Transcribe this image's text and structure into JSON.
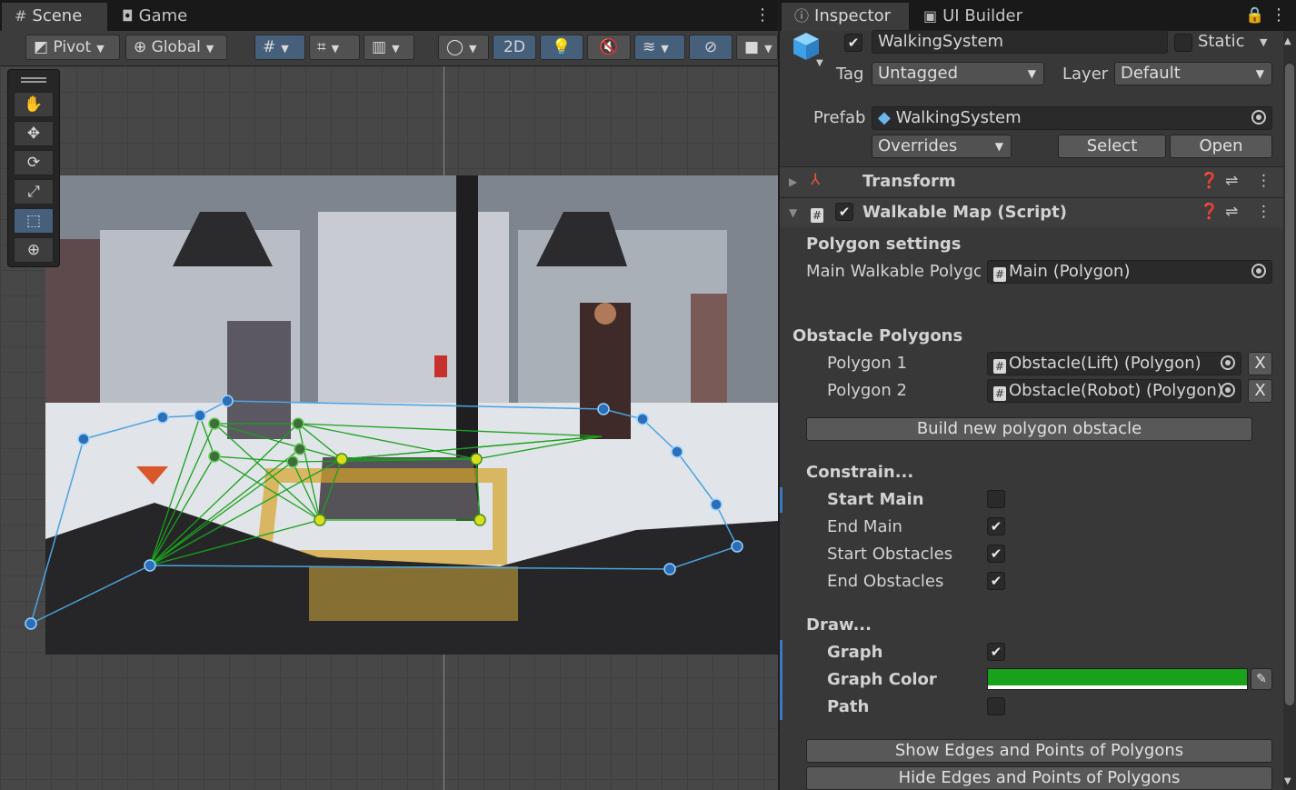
{
  "scene_window": {
    "tabs": [
      {
        "label": "Scene",
        "icon": "grid-icon"
      },
      {
        "label": "Game",
        "icon": "gamepad-icon"
      }
    ],
    "toolbar": {
      "pivot_label": "Pivot",
      "global_label": "Global",
      "mode_2d_label": "2D"
    },
    "tools": [
      "hand-tool",
      "move-tool",
      "rotate-tool",
      "scale-tool",
      "rect-tool",
      "transform-tool"
    ],
    "selected_tool": "rect-tool",
    "walkable_polygon_color": "#4aa3df",
    "graph_color": "#19a11c"
  },
  "inspector": {
    "tabs": [
      {
        "label": "Inspector",
        "icon": "info-icon"
      },
      {
        "label": "UI Builder",
        "icon": "ui-builder-icon"
      }
    ],
    "object_name": "WalkingSystem",
    "active": true,
    "static_label": "Static",
    "tag_label": "Tag",
    "tag_value": "Untagged",
    "layer_label": "Layer",
    "layer_value": "Default",
    "prefab_label": "Prefab",
    "prefab_value": "WalkingSystem",
    "overrides_label": "Overrides",
    "select_label": "Select",
    "open_label": "Open",
    "transform_header": "Transform",
    "script_header": "Walkable Map (Script)",
    "polygon_settings_label": "Polygon settings",
    "main_walkable_label": "Main Walkable Polygc",
    "main_walkable_value": "Main (Polygon)",
    "obstacle_polygons_label": "Obstacle Polygons",
    "obstacles": [
      {
        "label": "Polygon 1",
        "value": "Obstacle(Lift) (Polygon)",
        "remove": "X"
      },
      {
        "label": "Polygon 2",
        "value": "Obstacle(Robot) (Polygon)",
        "remove": "X"
      }
    ],
    "build_obstacle_label": "Build new polygon obstacle",
    "constrain_label": "Constrain...",
    "constrain_items": [
      {
        "label": "Start Main",
        "checked": false
      },
      {
        "label": "End Main",
        "checked": true
      },
      {
        "label": "Start Obstacles",
        "checked": true
      },
      {
        "label": "End Obstacles",
        "checked": true
      }
    ],
    "draw_label": "Draw...",
    "draw_items": [
      {
        "label": "Graph",
        "checked": true
      },
      {
        "label": "Graph Color",
        "color": "#19a11c"
      },
      {
        "label": "Path",
        "checked": false
      }
    ],
    "show_edges_label": "Show Edges and Points of Polygons",
    "hide_edges_label": "Hide Edges and Points of Polygons"
  }
}
